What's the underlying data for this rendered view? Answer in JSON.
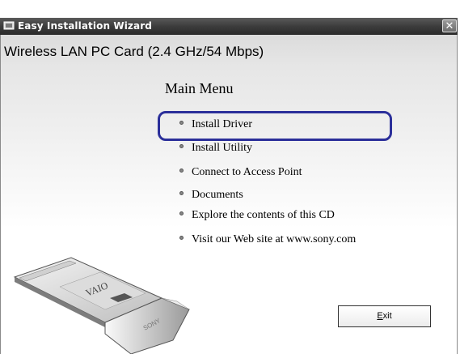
{
  "window": {
    "title": "Easy Installation Wizard",
    "close_glyph": "✕"
  },
  "product_name": "Wireless LAN PC Card (2.4 GHz/54 Mbps)",
  "menu": {
    "title": "Main Menu",
    "items": [
      {
        "label": "Install Driver",
        "selected": true
      },
      {
        "label": "Install Utility"
      },
      {
        "label": "Connect to Access Point"
      },
      {
        "label": "Documents"
      },
      {
        "label": "Explore the contents of this CD"
      },
      {
        "label": "Visit our Web site at www.sony.com"
      }
    ]
  },
  "exit_button": {
    "label_first": "E",
    "label_rest": "xit"
  },
  "card_image": {
    "brand_logo": "VAIO",
    "maker": "SONY"
  },
  "colors": {
    "highlight": "#2b2f9a",
    "titlebar": "#3c3c3c"
  }
}
